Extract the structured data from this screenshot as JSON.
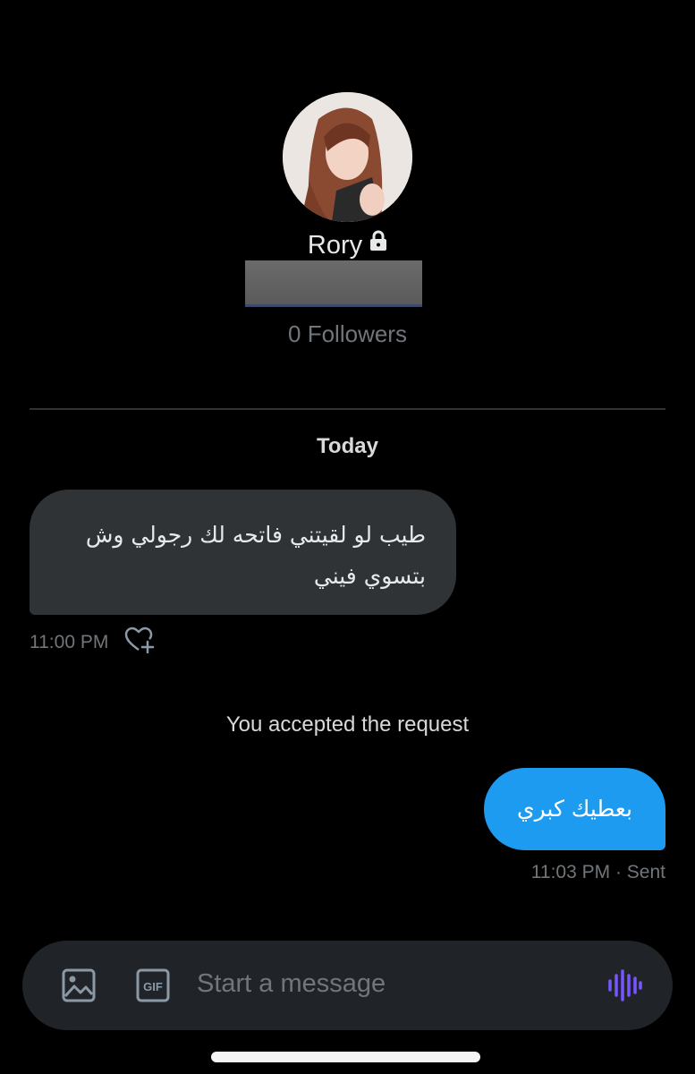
{
  "profile": {
    "name": "Rory",
    "followers_text": "0 Followers",
    "avatar_icon": "profile-avatar-illustration",
    "lock_icon": "lock-icon"
  },
  "conversation": {
    "date_separator": "Today",
    "messages": [
      {
        "direction": "incoming",
        "text": "طيب لو لقيتني فاتحه لك رجولي وش بتسوي فيني",
        "line1": "طيب لو لقيتني فاتحه لك رجولي وش",
        "line2": "بتسوي فيني",
        "time": "11:00 PM",
        "reaction_icon": "add-reaction-heart-icon"
      },
      {
        "direction": "system",
        "text": "You accepted the request"
      },
      {
        "direction": "outgoing",
        "text": "بعطيك كبري",
        "status": "11:03 PM · Sent"
      }
    ]
  },
  "composer": {
    "placeholder": "Start a message",
    "photo_icon": "image-icon",
    "gif_icon": "gif-icon",
    "voice_icon": "voice-message-icon"
  },
  "colors": {
    "background": "#000000",
    "incoming_bubble": "#2f3336",
    "outgoing_bubble": "#1d9bf0",
    "muted_text": "#71767b",
    "voice_accent": "#7856ff"
  }
}
